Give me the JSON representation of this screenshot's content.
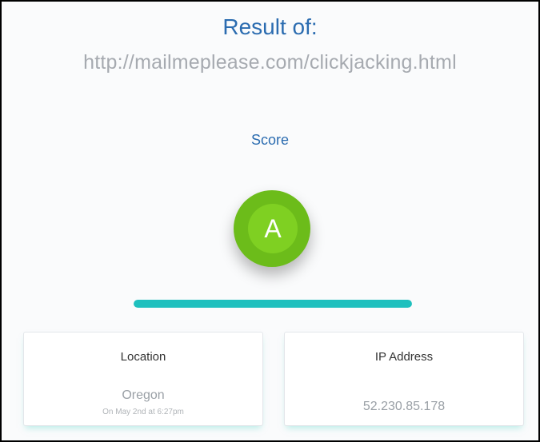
{
  "header": {
    "title": "Result of:",
    "url": "http://mailmeplease.com/clickjacking.html"
  },
  "score": {
    "label": "Score",
    "grade": "A",
    "progress_percent": 100
  },
  "cards": {
    "location": {
      "heading": "Location",
      "value": "Oregon",
      "subtext": "On May 2nd at 6:27pm"
    },
    "ip": {
      "heading": "IP Address",
      "value": "52.230.85.178"
    }
  },
  "colors": {
    "title": "#2b6cb0",
    "grade_outer": "#6cbc1a",
    "grade_inner": "#7fd022",
    "progress": "#1ec0be"
  }
}
